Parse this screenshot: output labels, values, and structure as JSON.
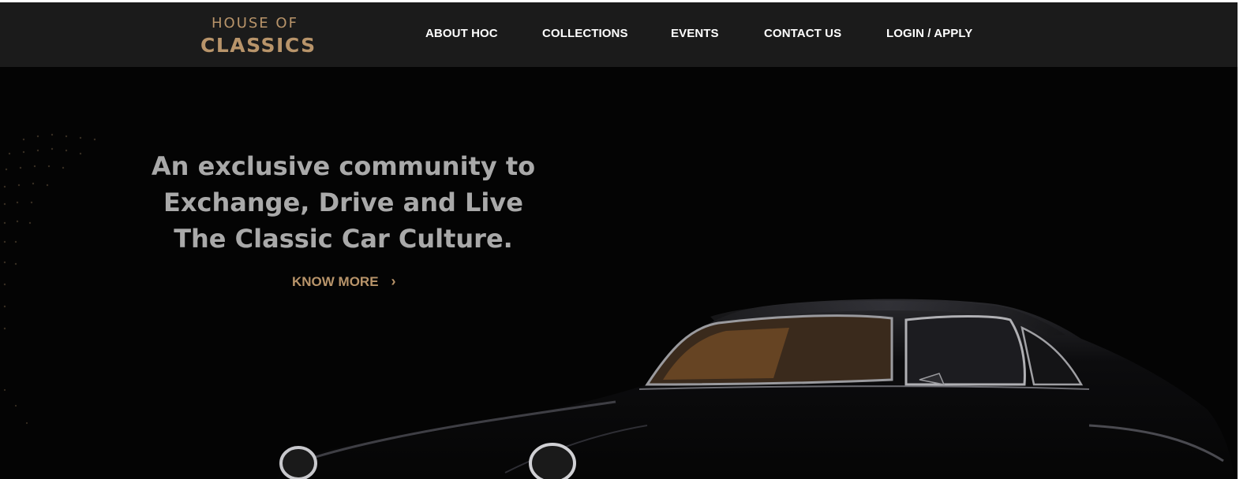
{
  "logo": {
    "line1": "HOUSE OF",
    "line2": "CLASSICS"
  },
  "nav": {
    "items": [
      {
        "label": "ABOUT HOC"
      },
      {
        "label": "COLLECTIONS"
      },
      {
        "label": "EVENTS"
      },
      {
        "label": "CONTACT US"
      },
      {
        "label": "LOGIN / APPLY"
      }
    ]
  },
  "hero": {
    "headline_lines": [
      "An exclusive community to",
      "Exchange, Drive and Live",
      "The Classic Car Culture."
    ],
    "cta_label": "KNOW MORE",
    "cta_icon": "chevron-right-icon"
  },
  "colors": {
    "accent_gold": "#b8946a",
    "nav_background": "#1b1b1b",
    "hero_background": "#040404",
    "headline_text": "#a9a9a9"
  }
}
